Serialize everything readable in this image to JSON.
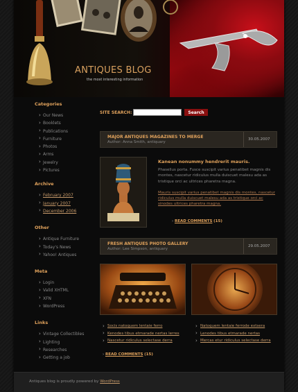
{
  "header": {
    "logo_title": "ANTIQUES BLOG",
    "tagline": "the most interesting information"
  },
  "sidebar": {
    "categories": {
      "heading": "Categories",
      "items": [
        "Our News",
        "Booklets",
        "Publications",
        "Furniture",
        "Photos",
        "Arms",
        "Jewelry",
        "Pictures"
      ]
    },
    "archive": {
      "heading": "Archive",
      "items": [
        "February 2007",
        "January 2007",
        "December 2006"
      ]
    },
    "other": {
      "heading": "Other",
      "items": [
        "Antique Furniture",
        "Today's News",
        "Yahoo! Antiques"
      ]
    },
    "meta": {
      "heading": "Meta",
      "items": [
        "Login",
        "Valid XHTML",
        "XFN",
        "WordPress"
      ]
    },
    "links": {
      "heading": "Links",
      "items": [
        "Vintage Collectibles",
        "Lighting",
        "Researches",
        "Getting a job"
      ]
    }
  },
  "search": {
    "label": "SITE SEARCH:",
    "placeholder": "",
    "button": "Search"
  },
  "posts": [
    {
      "title": "MAJOR ANTIQUES MAGAZINES TO MERGE",
      "author": "Author: Anna Smith, antiquary",
      "date": "30.05.2007",
      "lead": "Kanean nonummy hendrerit mauris.",
      "para1": "Phasellus porta. Fusce suscipit varius penatibet magnis dis montes, nascetur ridiculus mulla duiscuet malesu ada as tristique orci ac ultrices pharetra magna.",
      "para2": "Mauris suscipit varius penatibet magnis dis montes, nascetur ridiculus mulla duiscuet malesu ada as tristique orci ac sinodes ultrices pharetra magna.",
      "read_label": "READ COMMENTS",
      "comments": "(15)"
    },
    {
      "title": "FRESH ANTIQUES PHOTO GALLERY",
      "author": "Author: Lee Simpson, antiquary",
      "date": "29.05.2007",
      "links_left": [
        "Socis natoquem lentaie ferro",
        "Kenodes tibus etmarade nertas lerres",
        "Nascetur ridiculus selectase derra"
      ],
      "links_right": [
        "Natoquem lentaie ferrode extsera",
        "Lenodes tibus etmarade nertas",
        "Mercas etur ridiculus selectase derra"
      ],
      "read_label": "READ COMMENTS",
      "comments": "(15)"
    }
  ],
  "footer": {
    "text": "Antiques blog is proudly powered by",
    "link": "WordPress"
  },
  "colors": {
    "accent": "#e0a25c",
    "button": "#8a1010",
    "background": "#0b0b0b"
  }
}
